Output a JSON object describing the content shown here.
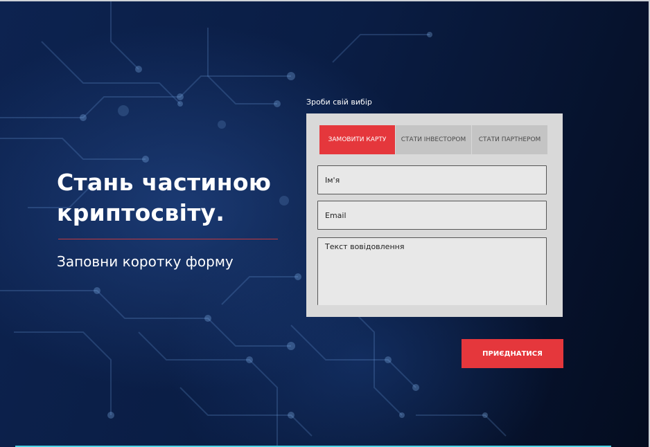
{
  "hero": {
    "title_line1": "Стань частиною",
    "title_line2": "криптосвіту.",
    "subtitle": "Заповни коротку форму"
  },
  "form": {
    "label": "Зроби свій вибір",
    "tabs": [
      {
        "label": "ЗАМОВИТИ КАРТУ",
        "active": true
      },
      {
        "label": "СТАТИ ІНВЕСТОРОМ",
        "active": false
      },
      {
        "label": "СТАТИ ПАРТНЕРОМ",
        "active": false
      }
    ],
    "fields": {
      "name_placeholder": "Ім'я",
      "email_placeholder": "Email",
      "message_placeholder": "Текст вовідовлення"
    },
    "submit_label": "ПРИЄДНАТИСЯ"
  },
  "colors": {
    "accent": "#e5373c",
    "background": "#0b1a3a",
    "card": "#d9d9d9",
    "tab_inactive": "#c4c4c4"
  },
  "background_decoration": "circuit-board-pattern"
}
